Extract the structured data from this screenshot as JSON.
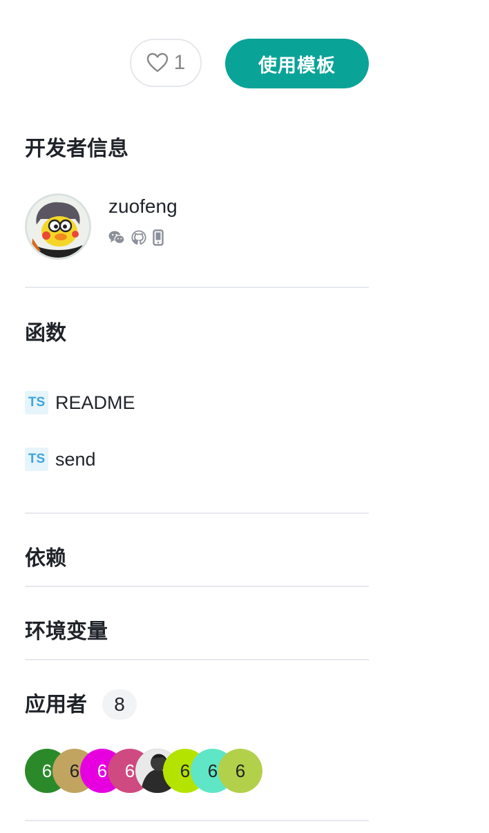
{
  "actions": {
    "like_count": "1",
    "use_template_label": "使用模板"
  },
  "developer": {
    "section_title": "开发者信息",
    "name": "zuofeng",
    "contact_icons": [
      "wechat-icon",
      "github-icon",
      "phone-icon"
    ]
  },
  "functions": {
    "section_title": "函数",
    "items": [
      {
        "badge": "TS",
        "name": "README"
      },
      {
        "badge": "TS",
        "name": "send"
      }
    ]
  },
  "dependencies": {
    "section_title": "依赖"
  },
  "env_vars": {
    "section_title": "环境变量"
  },
  "users": {
    "section_title": "应用者",
    "count": "8",
    "avatars": [
      {
        "label": "6",
        "bg": "#2a8a2a",
        "color": "#ffffff"
      },
      {
        "label": "6",
        "bg": "#c0a45f",
        "color": "#222222"
      },
      {
        "label": "6",
        "bg": "#e600e0",
        "color": "#ffffff"
      },
      {
        "label": "6",
        "bg": "#cf4a80",
        "color": "#ffffff"
      },
      {
        "label": "",
        "bg": "#2b2b2b",
        "color": "#ffffff",
        "photo": true
      },
      {
        "label": "6",
        "bg": "#b5e300",
        "color": "#222222"
      },
      {
        "label": "6",
        "bg": "#5ee6c6",
        "color": "#222222"
      },
      {
        "label": "6",
        "bg": "#b2d04a",
        "color": "#222222"
      }
    ]
  },
  "colors": {
    "accent": "#0aa398",
    "divider": "#e6e8ee",
    "ts_badge_bg": "#e6f4fb",
    "ts_badge_text": "#3fa4dc"
  }
}
